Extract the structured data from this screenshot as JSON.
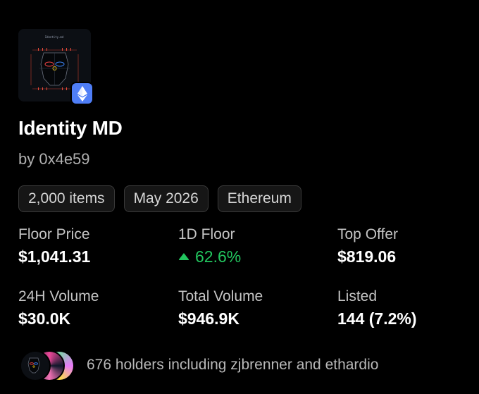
{
  "collection": {
    "name": "Identity MD",
    "creator": "by 0x4e59",
    "thumbnail_icon": "identity-md-thumbnail",
    "thumbnail_text": "Identity.md",
    "chain_icon": "ethereum-icon"
  },
  "tags": [
    "2,000 items",
    "May 2026",
    "Ethereum"
  ],
  "stats": {
    "floor_price": {
      "label": "Floor Price",
      "value": "$1,041.31"
    },
    "floor_1d": {
      "label": "1D Floor",
      "value": "62.6%",
      "trend": "up"
    },
    "top_offer": {
      "label": "Top Offer",
      "value": "$819.06"
    },
    "volume_24h": {
      "label": "24H Volume",
      "value": "$30.0K"
    },
    "total_volume": {
      "label": "Total Volume",
      "value": "$946.9K"
    },
    "listed": {
      "label": "Listed",
      "value": "144 (7.2%)"
    }
  },
  "holders": {
    "text": "676 holders including zjbrenner and ethardio"
  },
  "colors": {
    "background": "#000000",
    "positive": "#22c55e",
    "chain_badge": "#4f7ef7",
    "muted_text": "#b0b0b0"
  }
}
